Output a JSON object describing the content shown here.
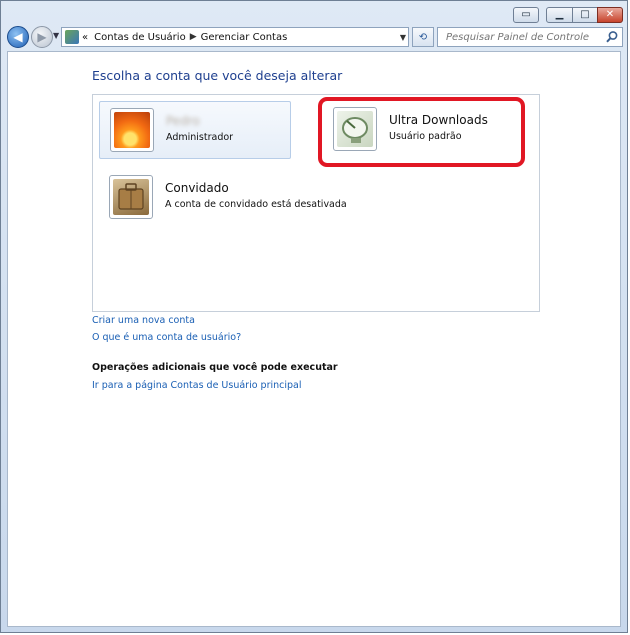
{
  "titlebar": {
    "buttons": [
      "extra",
      "minimize",
      "maximize",
      "close"
    ]
  },
  "nav": {
    "address_items": [
      "Contas de Usuário",
      "Gerenciar Contas"
    ],
    "address_prefix": "«",
    "search_placeholder": "Pesquisar Painel de Controle"
  },
  "main": {
    "heading": "Escolha a conta que você deseja alterar",
    "accounts": [
      {
        "name": "Pedro",
        "type": "Administrador"
      },
      {
        "name": "Ultra Downloads",
        "type": "Usuário padrão"
      },
      {
        "name": "Convidado",
        "type": "A conta de convidado está desativada"
      }
    ],
    "links": {
      "create": "Criar uma nova conta",
      "what_is": "O que é uma conta de usuário?"
    },
    "additional_title": "Operações adicionais que você pode executar",
    "main_page_link": "Ir para a página Contas de Usuário principal"
  },
  "colors": {
    "link": "#1a5fb4",
    "heading": "#1e3f8f",
    "highlight": "#e11724"
  }
}
